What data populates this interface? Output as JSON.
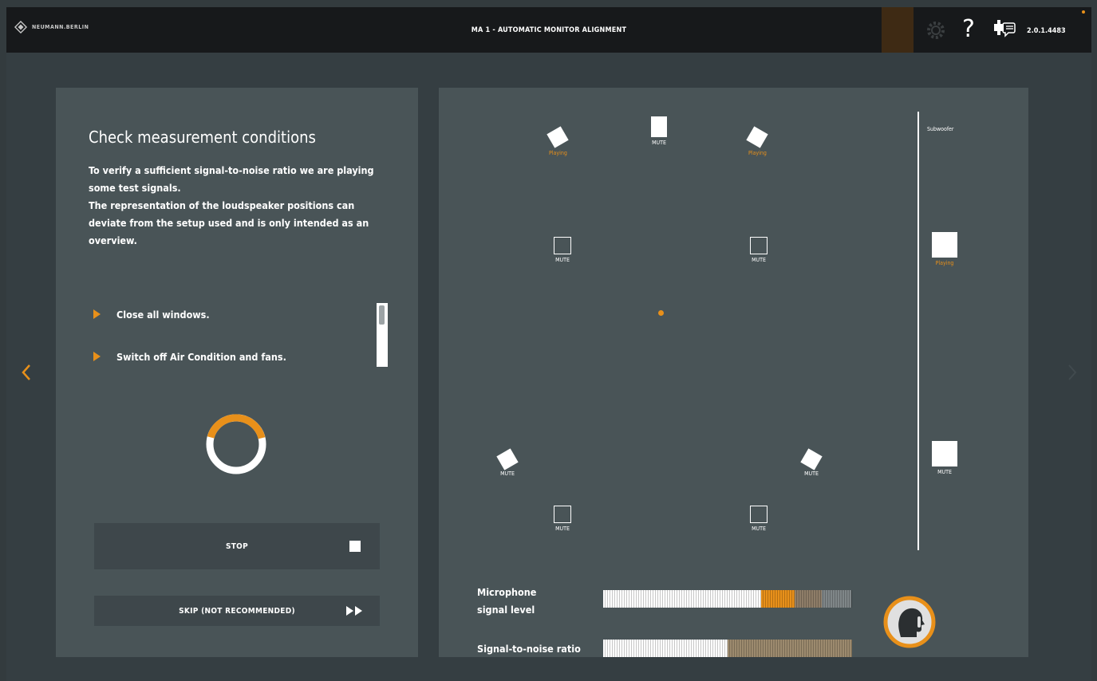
{
  "header": {
    "brand": "NEUMANN.BERLIN",
    "title": "MA 1 - AUTOMATIC MONITOR ALIGNMENT",
    "help_symbol": "?",
    "version": "2.0.1.4483",
    "icons": [
      "neumann-logo-icon",
      "gear-icon",
      "help-icon",
      "support-chat-icon"
    ]
  },
  "nav": {
    "prev_icon": "chevron-left-icon",
    "next_icon": "chevron-right-icon"
  },
  "left": {
    "title": "Check measurement conditions",
    "description_lines": [
      "To verify a sufficient signal-to-noise ratio we are playing",
      "some test signals.",
      "The representation of the loudspeaker positions can",
      "deviate from the setup used and is only intended as an",
      "overview."
    ],
    "checklist": [
      "Close all windows.",
      "Switch off Air Condition and fans."
    ],
    "progress_fraction": 0.42,
    "stop_label": "STOP",
    "skip_label": "SKIP (NOT RECOMMENDED)"
  },
  "right": {
    "subwoofer_title": "Subwoofer",
    "speakers": [
      {
        "id": "front-left",
        "label": "Playing",
        "state": "playing"
      },
      {
        "id": "front-center",
        "label": "MUTE",
        "state": "mute"
      },
      {
        "id": "front-right",
        "label": "Playing",
        "state": "playing"
      },
      {
        "id": "top-front-left",
        "label": "MUTE",
        "state": "mute"
      },
      {
        "id": "top-front-right",
        "label": "MUTE",
        "state": "mute"
      },
      {
        "id": "surround-left",
        "label": "MUTE",
        "state": "mute"
      },
      {
        "id": "surround-right",
        "label": "MUTE",
        "state": "mute"
      },
      {
        "id": "top-rear-left",
        "label": "MUTE",
        "state": "mute"
      },
      {
        "id": "top-rear-right",
        "label": "MUTE",
        "state": "mute"
      },
      {
        "id": "subwoofer-1",
        "label": "Playing",
        "state": "playing"
      },
      {
        "id": "subwoofer-2",
        "label": "MUTE",
        "state": "mute"
      }
    ],
    "mic_label_line1": "Microphone",
    "mic_label_line2": "signal level",
    "snr_label": "Signal-to-noise ratio",
    "mic_level": {
      "white_fraction": 0.635,
      "orange_fraction": 0.135,
      "tan_fraction": 0.11
    },
    "snr_level": {
      "white_fraction": 0.5
    },
    "mic_button_icon": "quiet-please-icon"
  },
  "colors": {
    "accent": "#e8901a",
    "panel": "#495457",
    "background": "#353e42",
    "topbar": "#17191b",
    "button": "#3e474b"
  }
}
